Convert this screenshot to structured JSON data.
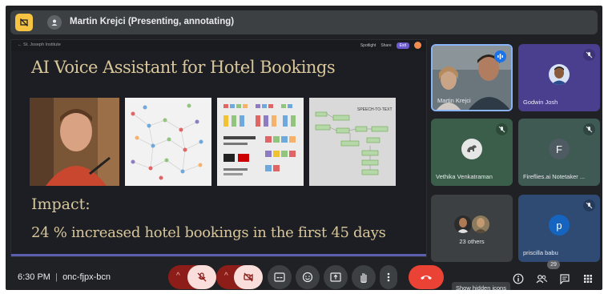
{
  "topbar": {
    "presenter_label": "Martin Krejci (Presenting, annotating)"
  },
  "slide": {
    "toolbar_left": "←  St. Joseph Institute",
    "toolbar_spotlight": "Spotlight",
    "toolbar_share": "Share",
    "toolbar_exit": "Exit",
    "title": "AI Voice Assistant for Hotel Bookings",
    "impact_heading": "Impact:",
    "impact_stat": "24 % increased hotel bookings in the first 45 days",
    "speech_label": "SPEECH-TO-TEXT"
  },
  "participants": [
    {
      "name": "Martin Krejci",
      "speaking": true
    },
    {
      "name": "Godwin Josh",
      "muted": true
    },
    {
      "name": "Vethika Venkatraman",
      "muted": true
    },
    {
      "name": "Fireflies.ai Notetaker ...",
      "initial": "F",
      "muted": true
    },
    {
      "name": "23 others"
    },
    {
      "name": "priscilla babu",
      "initial": "p",
      "muted": true
    }
  ],
  "controls": {
    "time": "6:30 PM",
    "meeting_code": "onc-fjpx-bcn",
    "tooltip": "Show hidden icons",
    "participant_count": "29"
  },
  "colors": {
    "background": "#202124",
    "accent_gold": "#d8c79a",
    "pin_yellow": "#f6c343",
    "end_call_red": "#ea4335",
    "muted_bg": "#f9dedc"
  }
}
